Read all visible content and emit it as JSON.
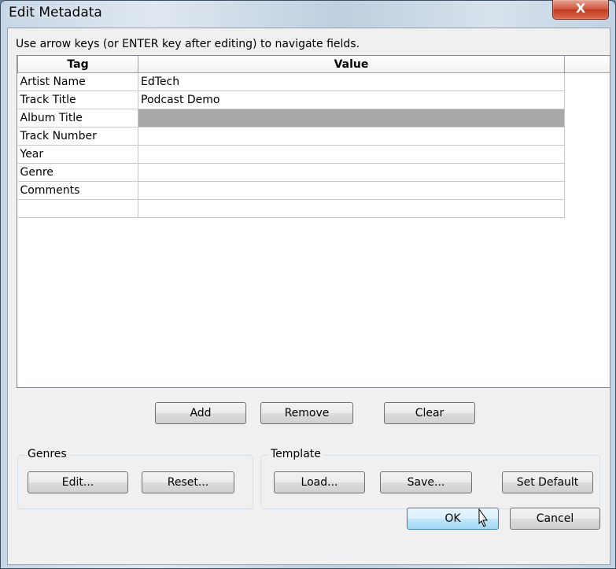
{
  "window": {
    "title": "Edit Metadata",
    "close_glyph": "X"
  },
  "hint": "Use arrow keys (or ENTER key after editing) to navigate fields.",
  "table": {
    "columns": [
      "Tag",
      "Value"
    ],
    "rows": [
      {
        "tag": "Artist Name",
        "value": "EdTech"
      },
      {
        "tag": "Track Title",
        "value": "Podcast Demo"
      },
      {
        "tag": "Album Title",
        "value": ""
      },
      {
        "tag": "Track Number",
        "value": ""
      },
      {
        "tag": "Year",
        "value": ""
      },
      {
        "tag": "Genre",
        "value": ""
      },
      {
        "tag": "Comments",
        "value": ""
      },
      {
        "tag": "",
        "value": ""
      }
    ],
    "selected_row": 2
  },
  "row_buttons": {
    "add": "Add",
    "remove": "Remove",
    "clear": "Clear"
  },
  "genres": {
    "label": "Genres",
    "edit": "Edit...",
    "reset": "Reset..."
  },
  "template": {
    "label": "Template",
    "load": "Load...",
    "save": "Save...",
    "set_default": "Set Default"
  },
  "dialog_buttons": {
    "ok": "OK",
    "cancel": "Cancel"
  },
  "colors": {
    "selected_cell": "#a9a9a9",
    "close_button": "#c7432a",
    "default_button_border": "#3c7fb1"
  },
  "icons": {
    "close": "close-icon",
    "cursor": "mouse-pointer-icon"
  }
}
